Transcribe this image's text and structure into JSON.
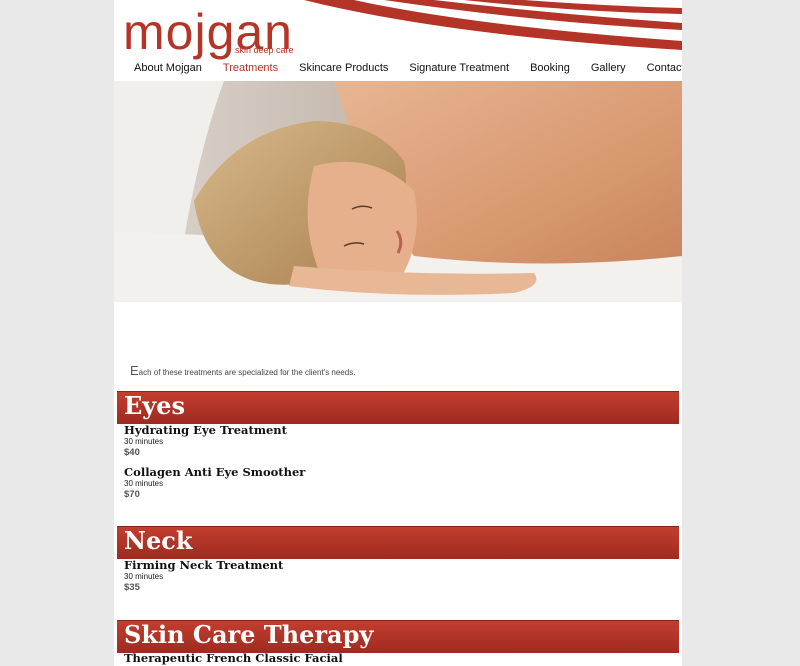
{
  "brand": {
    "name": "mojgan",
    "tagline": "skin deep care"
  },
  "nav": {
    "items": [
      {
        "label": "About Mojgan"
      },
      {
        "label": "Treatments"
      },
      {
        "label": "Skincare Products"
      },
      {
        "label": "Signature Treatment"
      },
      {
        "label": "Booking"
      },
      {
        "label": "Gallery"
      },
      {
        "label": "Contact"
      }
    ],
    "active": "Treatments"
  },
  "intro": {
    "first_letter": "E",
    "rest": "ach of these treatments are specialized for the client's needs."
  },
  "sections": [
    {
      "title": "Eyes",
      "items": [
        {
          "name": "Hydrating Eye Treatment",
          "duration": "30 minutes",
          "price": "$40"
        },
        {
          "name": "Collagen Anti Eye Smoother",
          "duration": "30 minutes",
          "price": "$70"
        }
      ]
    },
    {
      "title": "Neck",
      "items": [
        {
          "name": "Firming Neck Treatment",
          "duration": "30 minutes",
          "price": "$35"
        }
      ]
    },
    {
      "title": "Skin Care Therapy",
      "items": [
        {
          "name": "Therapeutic French Classic Facial"
        }
      ]
    }
  ],
  "colors": {
    "accent": "#b43427",
    "background": "#e9e9e9"
  }
}
